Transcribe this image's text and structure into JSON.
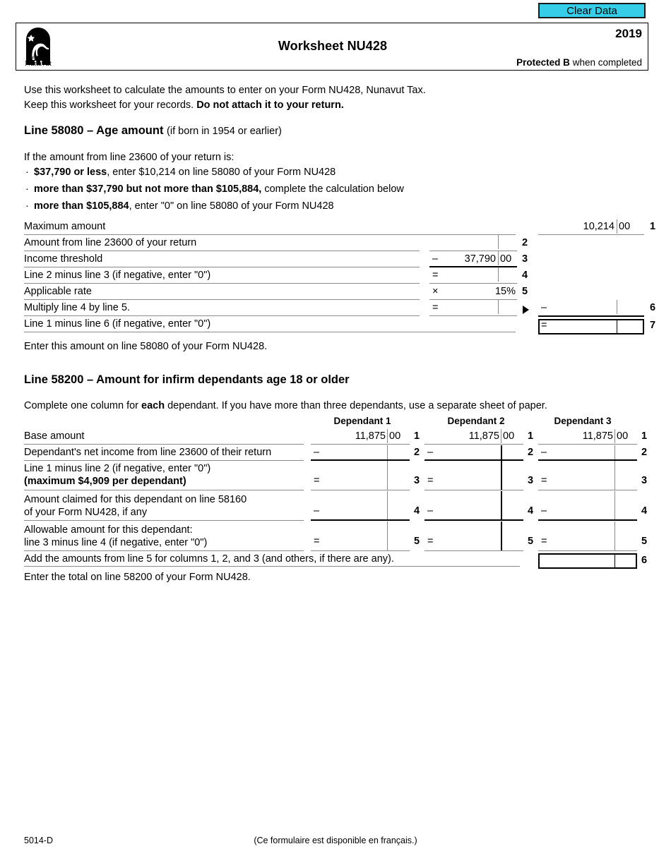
{
  "toolbar": {
    "clear_data_label": "Clear Data"
  },
  "header": {
    "title": "Worksheet NU428",
    "year": "2019",
    "protected_bold": "Protected B",
    "protected_rest": " when completed",
    "logo_name": "Nunavut",
    "logo_alt": "Nunavut"
  },
  "intro": {
    "line1": "Use this worksheet to calculate the amounts to enter on your Form NU428, Nunavut Tax.",
    "line2_a": "Keep this worksheet for your records. ",
    "line2_b": "Do not attach it to your return."
  },
  "section1": {
    "heading_main": "Line 58080 – Age amount ",
    "heading_sub": "(if born in 1954 or earlier)",
    "lead": "If the amount from line 23600 of your return is:",
    "bullets": [
      {
        "bold": "$37,790 or less",
        "rest": ", enter $10,214 on line 58080 of your Form NU428"
      },
      {
        "bold": "more than $37,790 but not more than $105,884,",
        "rest": " complete the calculation below"
      },
      {
        "bold": "more than $105,884",
        "rest": ", enter \"0\" on line 58080 of your Form NU428"
      }
    ],
    "rows": [
      {
        "label": "Maximum amount",
        "no": "1",
        "op": "",
        "value": "10,214",
        "cents": "00"
      },
      {
        "label": "Amount from line 23600 of your return",
        "no": "2",
        "op": "",
        "value": "",
        "cents": ""
      },
      {
        "label": "Income threshold",
        "no": "3",
        "op": "–",
        "value": "37,790",
        "cents": "00"
      },
      {
        "label": "Line 2 minus line 3 (if negative, enter \"0\")",
        "no": "4",
        "op": "=",
        "value": "",
        "cents": ""
      },
      {
        "label": "Applicable rate",
        "no": "5",
        "op": "×",
        "value": "15%",
        "cents": ""
      },
      {
        "label": "Multiply line 4 by line 5.",
        "no": "6",
        "op": "=",
        "value": "",
        "cents": ""
      },
      {
        "label": "Line 1 minus line 6 (if negative, enter \"0\")",
        "no": "7",
        "op": "=",
        "value": "",
        "cents": ""
      }
    ],
    "right_op_6": "–",
    "right_op_7": "=",
    "after_note": "Enter this amount on line 58080 of your Form NU428."
  },
  "section2": {
    "heading": "Line 58200 – Amount for infirm dependants age 18 or older",
    "lead_a": "Complete one column for ",
    "lead_b": "each",
    "lead_c": " dependant. If you have more than three dependants, use a separate sheet of paper.",
    "column_headers": [
      "Dependant 1",
      "Dependant 2",
      "Dependant 3"
    ],
    "rows": [
      {
        "label_line1": "Base amount",
        "label_line2": "",
        "no": "1",
        "op": "",
        "value": "11,875",
        "cents": "00"
      },
      {
        "label_line1": "Dependant's net income from line 23600 of their return",
        "label_line2": "",
        "no": "2",
        "op": "–",
        "value": "",
        "cents": ""
      },
      {
        "label_line1": "Line 1 minus line 2 (if negative, enter \"0\")",
        "label_line2": "(maximum $4,909 per dependant)",
        "label_line2_bold": true,
        "no": "3",
        "op": "=",
        "value": "",
        "cents": ""
      },
      {
        "label_line1": "Amount claimed for this dependant on line 58160",
        "label_line2": "of your Form NU428, if any",
        "label_line2_bold": false,
        "no": "4",
        "op": "–",
        "value": "",
        "cents": ""
      },
      {
        "label_line1": "Allowable amount for this dependant:",
        "label_line2": "line 3 minus line 4 (if negative, enter \"0\")",
        "label_line2_bold": false,
        "no": "5",
        "op": "=",
        "value": "",
        "cents": ""
      }
    ],
    "total_row": {
      "label": "Add the amounts from line 5 for columns 1, 2, and 3 (and others, if there are any).",
      "no": "6"
    },
    "after_note": "Enter the total on line 58200 of your Form NU428."
  },
  "footer": {
    "code": "5014-D",
    "french_note": "(Ce formulaire est disponible en français.)"
  },
  "colors": {
    "clear_data_bg": "#35CDE8",
    "rule_light": "#8a8a8a",
    "rule_dark": "#000000"
  }
}
